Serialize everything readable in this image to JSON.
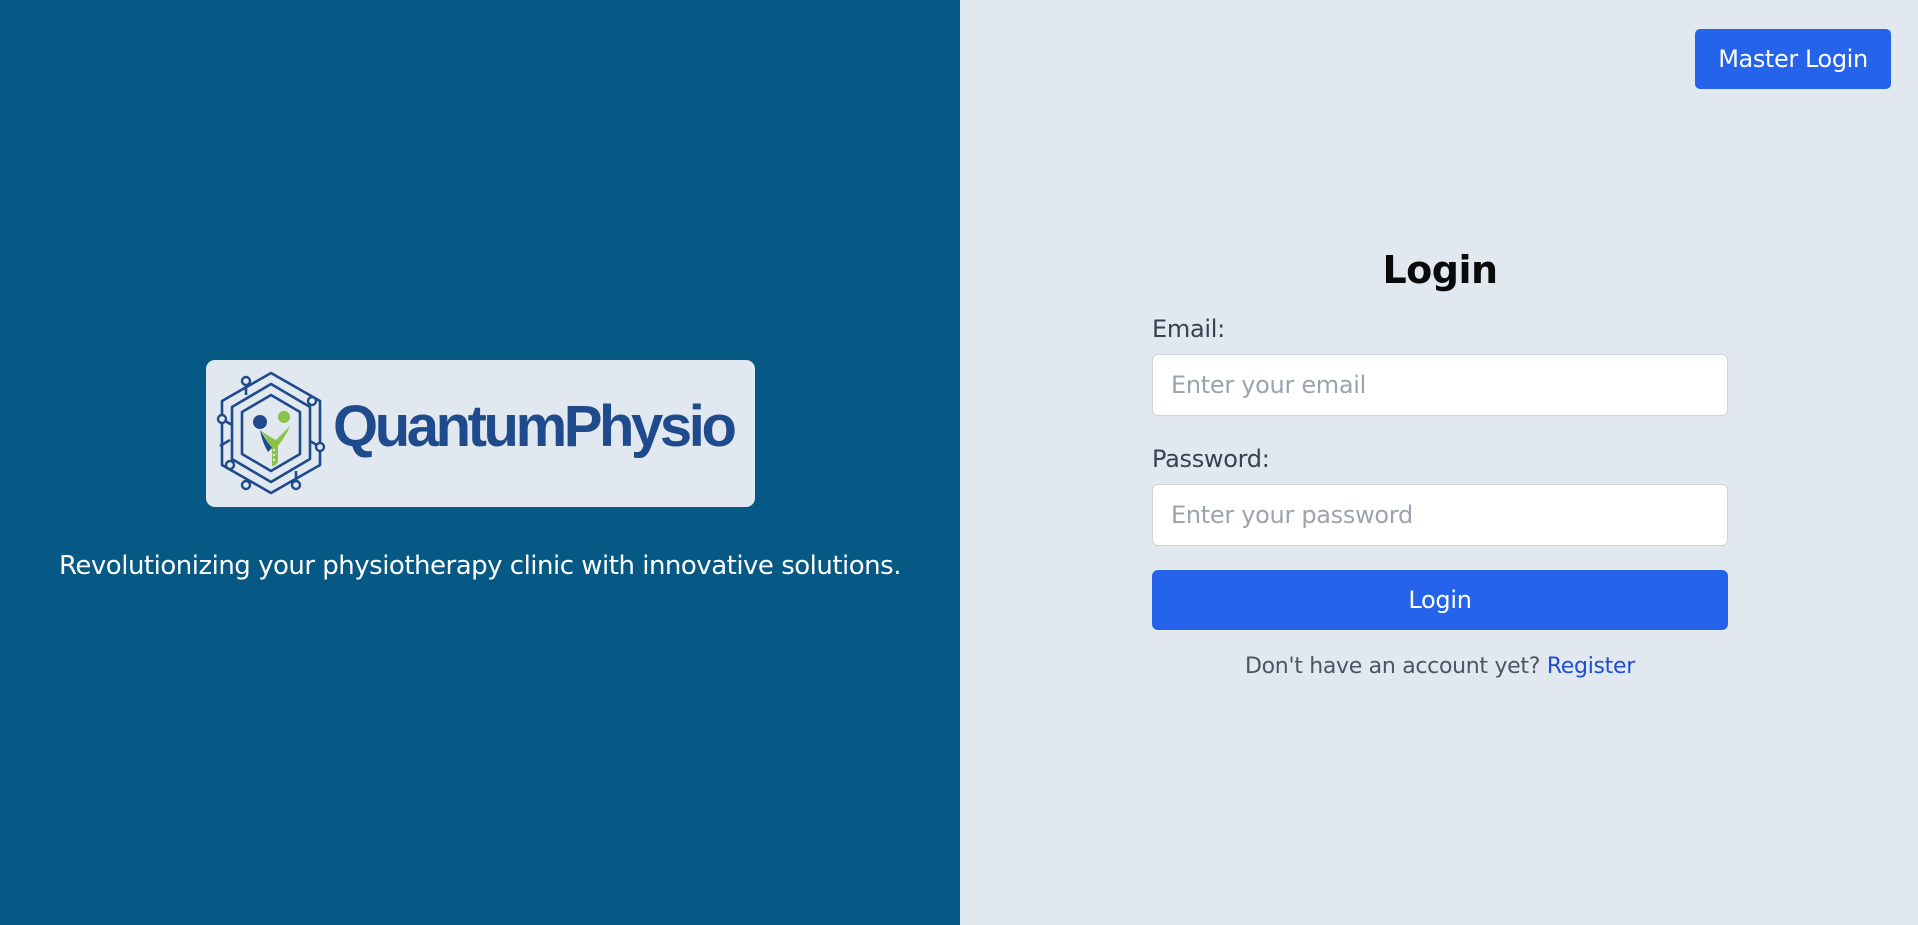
{
  "brand": {
    "logo_text": "QuantumPhysio",
    "tagline": "Revolutionizing your physiotherapy clinic with innovative solutions.",
    "colors": {
      "panel": "#065985",
      "logo_blue": "#1f4a8c",
      "logo_green": "#8bc34a"
    }
  },
  "header": {
    "master_login_label": "Master Login"
  },
  "login": {
    "title": "Login",
    "email_label": "Email:",
    "email_placeholder": "Enter your email",
    "email_value": "",
    "password_label": "Password:",
    "password_placeholder": "Enter your password",
    "password_value": "",
    "submit_label": "Login",
    "register_prompt": "Don't have an account yet?",
    "register_link": "Register"
  },
  "theme": {
    "accent": "#2563eb",
    "background": "#e2e8f0"
  }
}
